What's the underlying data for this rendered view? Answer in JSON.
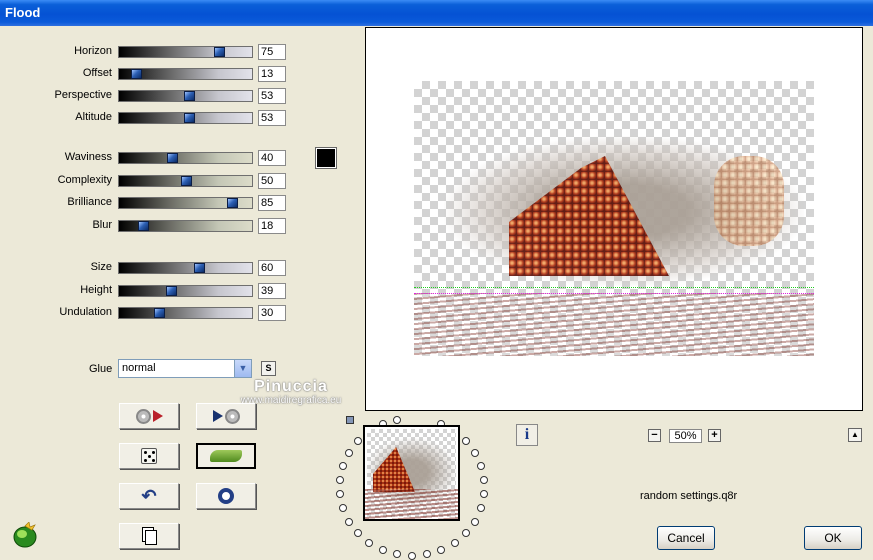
{
  "window": {
    "title": "Flood"
  },
  "sliders": [
    {
      "id": "horizon",
      "label": "Horizon",
      "value": "75",
      "fraction": 0.75,
      "style": "gray"
    },
    {
      "id": "offset",
      "label": "Offset",
      "value": "13",
      "fraction": 0.13,
      "style": "gray"
    },
    {
      "id": "perspective",
      "label": "Perspective",
      "value": "53",
      "fraction": 0.53,
      "style": "gray"
    },
    {
      "id": "altitude",
      "label": "Altitude",
      "value": "53",
      "fraction": 0.53,
      "style": "gray"
    },
    {
      "id": "waviness",
      "label": "Waviness",
      "value": "40",
      "fraction": 0.4,
      "style": "green"
    },
    {
      "id": "complexity",
      "label": "Complexity",
      "value": "50",
      "fraction": 0.5,
      "style": "green"
    },
    {
      "id": "brilliance",
      "label": "Brilliance",
      "value": "85",
      "fraction": 0.85,
      "style": "green"
    },
    {
      "id": "blur",
      "label": "Blur",
      "value": "18",
      "fraction": 0.18,
      "style": "green"
    },
    {
      "id": "size",
      "label": "Size",
      "value": "60",
      "fraction": 0.6,
      "style": "gray"
    },
    {
      "id": "height",
      "label": "Height",
      "value": "39",
      "fraction": 0.39,
      "style": "gray"
    },
    {
      "id": "undulation",
      "label": "Undulation",
      "value": "30",
      "fraction": 0.3,
      "style": "gray"
    }
  ],
  "color_swatch": {
    "color": "#000000"
  },
  "glue": {
    "label": "Glue",
    "value": "normal",
    "side_button": "S"
  },
  "watermark": {
    "line1": "Pinuccia",
    "line2": "www.maidiregrafica.eu"
  },
  "icons": {
    "load": "load-preset-icon",
    "save": "save-preset-icon",
    "random": "dice-icon",
    "wave": "wave-icon",
    "reset": "undo-icon",
    "ring": "ring-icon",
    "copy": "copy-icon",
    "logo": "filter-logo-icon",
    "info": "info-icon"
  },
  "preview": {
    "zoom": "50%",
    "zoom_minus": "−",
    "zoom_plus": "+",
    "up_arrow": "▲",
    "info_label": "i"
  },
  "settings_file": "random settings.q8r",
  "buttons": {
    "cancel": "Cancel",
    "ok": "OK"
  }
}
